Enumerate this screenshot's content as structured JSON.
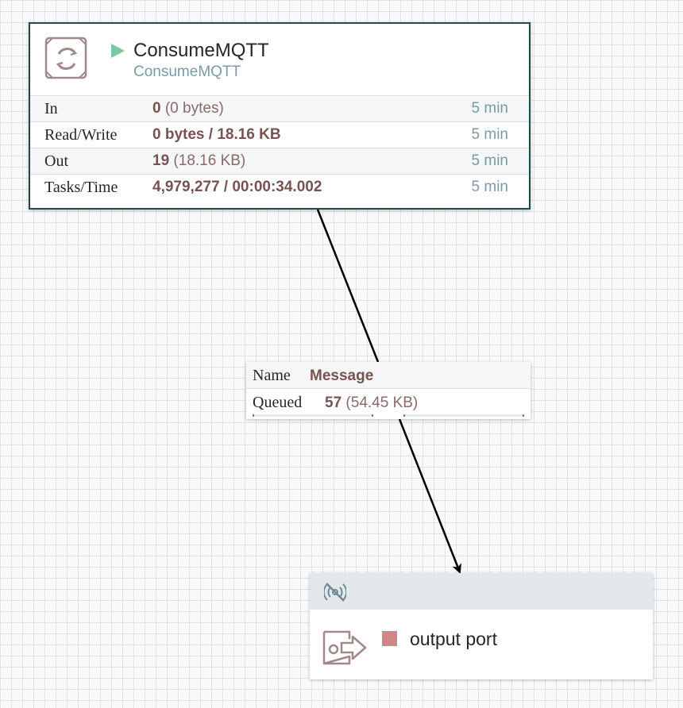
{
  "processor": {
    "name": "ConsumeMQTT",
    "type": "ConsumeMQTT",
    "status_icon": "play-icon",
    "status_color": "#7dc7a0",
    "border_color": "#1d4a4a",
    "stats": [
      {
        "label": "In",
        "primary": "0",
        "secondary": "(0 bytes)",
        "time": "5 min"
      },
      {
        "label": "Read/Write",
        "primary": "0 bytes / 18.16 KB",
        "secondary": "",
        "time": "5 min"
      },
      {
        "label": "Out",
        "primary": "19",
        "secondary": "(18.16 KB)",
        "time": "5 min"
      },
      {
        "label": "Tasks/Time",
        "primary": "4,979,277 / 00:00:34.002",
        "secondary": "",
        "time": "5 min"
      }
    ]
  },
  "connection": {
    "name_key": "Name",
    "name_value": "Message",
    "queued_key": "Queued",
    "queued_primary": "57",
    "queued_secondary": "(54.45 KB)"
  },
  "output_port": {
    "name": "output port",
    "transmit_icon": "transmission-disabled-icon",
    "status_icon": "stopped-icon",
    "status_color": "#d18686"
  },
  "colors": {
    "value_text": "#775351",
    "secondary_text": "#7a9ba3",
    "canvas_grid": "#dfe3e6"
  }
}
